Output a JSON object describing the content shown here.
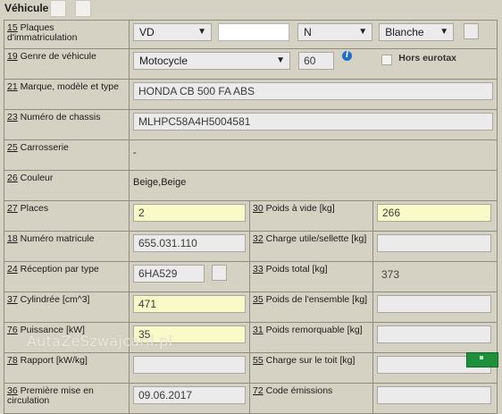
{
  "header": {
    "title": "Véhicule"
  },
  "rows": {
    "plates": {
      "num": "15",
      "label": "Plaques d'immatriculation",
      "canton": "VD",
      "number": "",
      "type": "N",
      "color": "Blanche"
    },
    "genre": {
      "num": "19",
      "label": "Genre de véhicule",
      "value": "Motocycle",
      "code": "60",
      "info": "i",
      "hors_eurotax_label": "Hors eurotax"
    },
    "marque": {
      "num": "21",
      "label": "Marque, modèle et type",
      "value": "HONDA CB 500 FA ABS"
    },
    "chassis": {
      "num": "23",
      "label": "Numéro de chassis",
      "value": "MLHPC58A4H5004581"
    },
    "carrosserie": {
      "num": "25",
      "label": "Carrosserie",
      "value": "-"
    },
    "couleur": {
      "num": "26",
      "label": "Couleur",
      "value": "Beige,Beige"
    },
    "places": {
      "num": "27",
      "label": "Places",
      "value": "2"
    },
    "poids_vide": {
      "num": "30",
      "label": "Poids à vide [kg]",
      "value": "266"
    },
    "matricule": {
      "num": "18",
      "label": "Numéro matricule",
      "value": "655.031.110"
    },
    "charge_utile": {
      "num": "32",
      "label": "Charge utile/sellette [kg]",
      "value": ""
    },
    "reception": {
      "num": "24",
      "label": "Réception par type",
      "value": "6HA529"
    },
    "poids_total": {
      "num": "33",
      "label": "Poids total [kg]",
      "value": "373"
    },
    "cylindree": {
      "num": "37",
      "label": "Cylindrée [cm^3]",
      "value": "471"
    },
    "poids_ensemble": {
      "num": "35",
      "label": "Poids de l'ensemble [kg]",
      "value": ""
    },
    "puissance": {
      "num": "76",
      "label": "Puissance [kW]",
      "value": "35"
    },
    "poids_remorquable": {
      "num": "31",
      "label": "Poids remorquable [kg]",
      "value": ""
    },
    "rapport": {
      "num": "78",
      "label": "Rapport [kW/kg]",
      "value": ""
    },
    "charge_toit": {
      "num": "55",
      "label": "Charge sur le toit [kg]",
      "value": ""
    },
    "premiere_mise": {
      "num": "36",
      "label": "Première mise en circulation",
      "value": "09.06.2017"
    },
    "code_emissions": {
      "num": "72",
      "label": "Code émissions",
      "value": ""
    }
  },
  "watermark": "AutaZeSzwajcarii.pl",
  "colors": {
    "yellow_field": "#fafac8",
    "grey_field": "#ebebeb",
    "background": "#d6d2c3",
    "info_blue": "#1e6fc9",
    "green_button": "#1e8f3a"
  }
}
